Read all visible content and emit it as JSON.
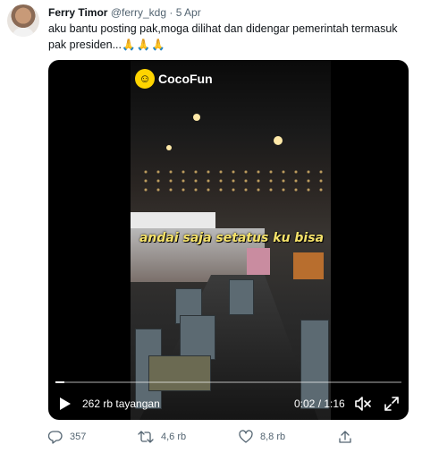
{
  "tweet": {
    "author_name": "Ferry Timor",
    "author_handle": "@ferry_kdg",
    "separator": "·",
    "date": "5 Apr",
    "text": "aku bantu posting pak,moga dilihat dan didengar pemerintah termasuk pak presiden...",
    "text_emoji": "🙏🙏🙏"
  },
  "video": {
    "watermark": "CocoFun",
    "watermark_mark": "☺",
    "caption": "andai saja setatus ku bisa",
    "views": "262 rb tayangan",
    "time": "0:02 / 1:16",
    "progress_fraction": 0.026,
    "play_icon": "play-icon",
    "mute_icon": "volume-muted-icon",
    "fullscreen_icon": "fullscreen-icon"
  },
  "actions": {
    "replies": "357",
    "retweets": "4,6 rb",
    "likes": "8,8 rb"
  },
  "colors": {
    "text_primary": "#0f1419",
    "text_secondary": "#536471",
    "caption_yellow": "#f5e26a",
    "logo_yellow": "#ffd400"
  }
}
